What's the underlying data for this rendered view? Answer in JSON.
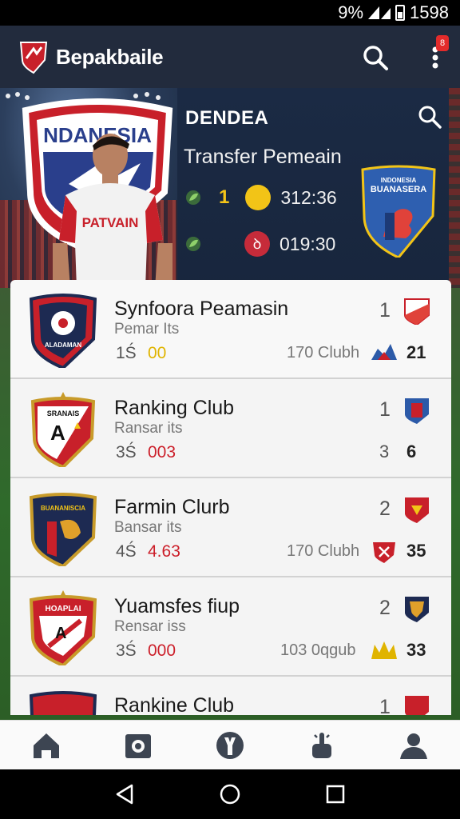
{
  "status": {
    "battery": "9%",
    "time": "1598"
  },
  "app": {
    "title": "Bepakbaile"
  },
  "hero": {
    "name": "DENDEA",
    "subtitle": "Transfer Pemeain",
    "row1": {
      "count": "1",
      "time": "312:36"
    },
    "row2": {
      "time": "019:30",
      "icon": "ꝺ"
    },
    "crest_text": "BUANASERA",
    "shield_text": "NDANESIA",
    "jersey_text": "PATVAIN"
  },
  "clubs": [
    {
      "title": "Synfoora Peamasin",
      "subtitle": "Pemar Its",
      "stat_label": "1Ś",
      "stat_value": "00",
      "stat_color": "#e0b400",
      "mid": "170 Clubh",
      "rank": "1",
      "count": "21",
      "logo_text": "ALADAMAN"
    },
    {
      "title": "Ranking Club",
      "subtitle": "Ransar its",
      "stat_label": "3Ś",
      "stat_value": "003",
      "stat_color": "#cc1f2a",
      "mid": "",
      "rank": "1",
      "mid_num": "3",
      "count": "6",
      "logo_text": "SRANAIS"
    },
    {
      "title": "Farmin Clurb",
      "subtitle": "Bansar its",
      "stat_label": "4Ś",
      "stat_value": "4.63",
      "stat_color": "#cc1f2a",
      "mid": "170 Clubh",
      "rank": "2",
      "count": "35",
      "logo_text": "BUANANISCIA"
    },
    {
      "title": "Yuamsfes fiup",
      "subtitle": "Rensar iss",
      "stat_label": "3Ś",
      "stat_value": "000",
      "stat_color": "#cc1f2a",
      "mid": "103  0qgub",
      "rank": "2",
      "count": "33",
      "logo_text": "HOAPLAI"
    },
    {
      "title": "Rankine Club",
      "rank": "1"
    }
  ],
  "nav": [
    "home-icon",
    "camera-icon",
    "tool-icon",
    "pointer-icon",
    "profile-icon"
  ],
  "colors": {
    "appbar": "#222b3d",
    "accent_red": "#cc1f2a",
    "accent_gold": "#e0b400"
  }
}
